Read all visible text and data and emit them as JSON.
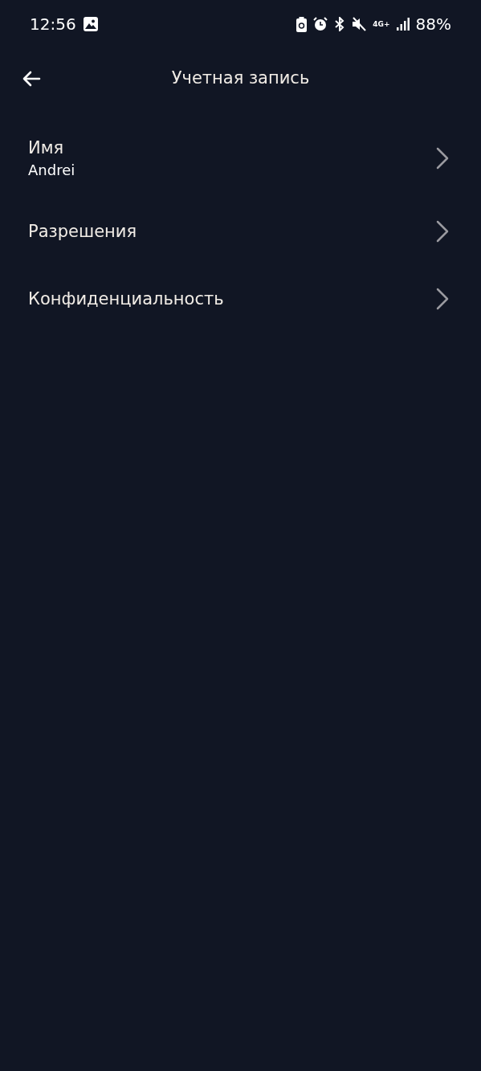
{
  "status_bar": {
    "time": "12:56",
    "network": "4G+",
    "battery": "88%"
  },
  "header": {
    "title": "Учетная запись"
  },
  "items": [
    {
      "label": "Имя",
      "value": "Andrei"
    },
    {
      "label": "Разрешения"
    },
    {
      "label": "Конфиденциальность"
    }
  ]
}
